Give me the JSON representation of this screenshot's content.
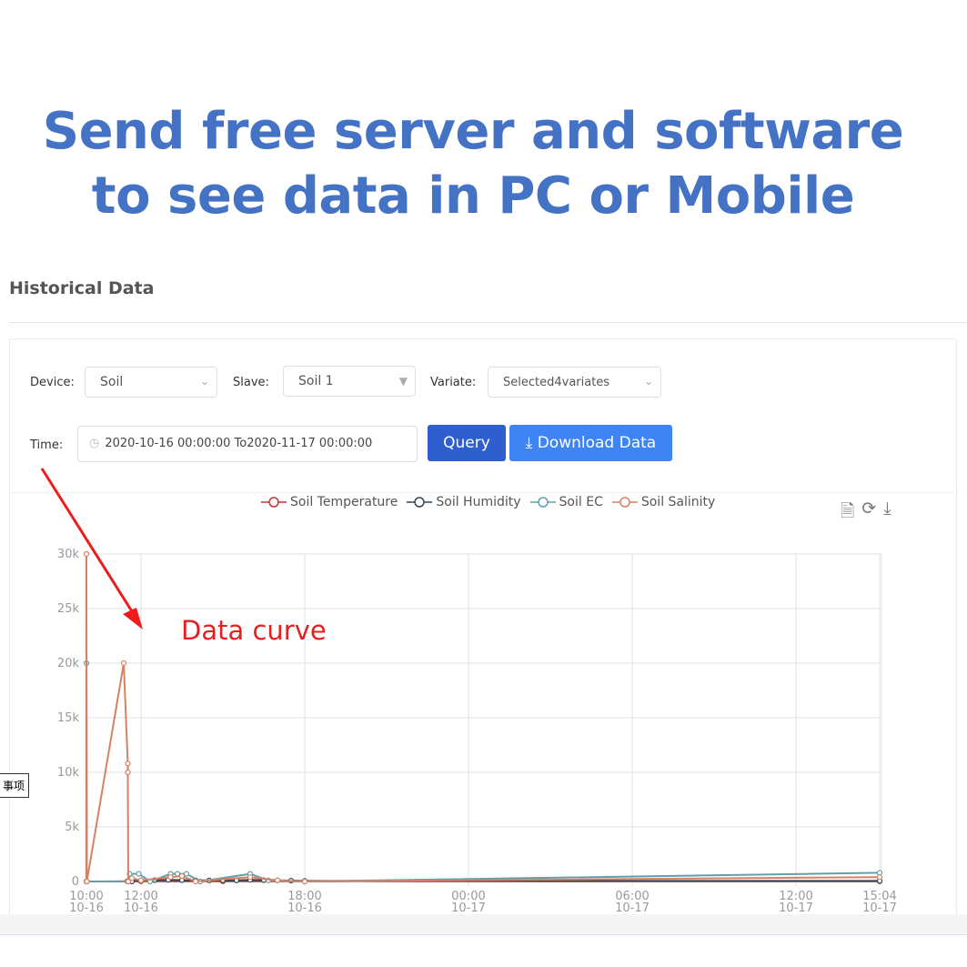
{
  "headline": {
    "line1": "Send free server and software",
    "line2": "to see data in PC or Mobile"
  },
  "page": {
    "title": "Historical Data"
  },
  "filters": {
    "device_label": "Device:",
    "device_value": "Soil",
    "slave_label": "Slave:",
    "slave_value": "Soil 1",
    "variate_label": "Variate:",
    "variate_value": "Selected4variates",
    "time_label": "Time:",
    "time_value": "2020-10-16 00:00:00 To2020-11-17 00:00:00"
  },
  "buttons": {
    "query": "Query",
    "download": "Download Data"
  },
  "annotation": "Data curve",
  "side_tab": "事项",
  "colors": {
    "title": "#4472c4",
    "query": "#2f5fcf",
    "download": "#3f84f5",
    "annotation": "#e62020"
  },
  "chart_data": {
    "type": "line",
    "ylim": [
      0,
      30000
    ],
    "yticks": [
      "0",
      "5k",
      "10k",
      "15k",
      "20k",
      "25k",
      "30k"
    ],
    "xticks": [
      {
        "t": "10-16 10:00",
        "l1": "10:00",
        "l2": "10-16"
      },
      {
        "t": "10-16 12:00",
        "l1": "12:00",
        "l2": "10-16"
      },
      {
        "t": "10-16 18:00",
        "l1": "18:00",
        "l2": "10-16"
      },
      {
        "t": "10-17 00:00",
        "l1": "00:00",
        "l2": "10-17"
      },
      {
        "t": "10-17 06:00",
        "l1": "06:00",
        "l2": "10-17"
      },
      {
        "t": "10-17 12:00",
        "l1": "12:00",
        "l2": "10-17"
      },
      {
        "t": "10-17 15:04",
        "l1": "15:04",
        "l2": "10-17"
      }
    ],
    "grid": true,
    "legend_position": "top",
    "series": [
      {
        "name": "Soil Temperature",
        "color": "#c23531",
        "points": [
          [
            "10-16 10:00",
            0
          ],
          [
            "10-16 11:30",
            20
          ],
          [
            "10-16 12:00",
            20
          ],
          [
            "10-16 15:00",
            20
          ],
          [
            "10-16 18:00",
            20
          ],
          [
            "10-17 15:04",
            20
          ]
        ]
      },
      {
        "name": "Soil Humidity",
        "color": "#2f4554",
        "points": [
          [
            "10-16 11:40",
            0
          ],
          [
            "10-16 12:00",
            100
          ],
          [
            "10-16 12:30",
            120
          ],
          [
            "10-16 13:00",
            150
          ],
          [
            "10-16 13:30",
            120
          ],
          [
            "10-16 14:00",
            100
          ],
          [
            "10-16 14:30",
            100
          ],
          [
            "10-16 15:00",
            100
          ],
          [
            "10-16 15:30",
            100
          ],
          [
            "10-16 16:00",
            150
          ],
          [
            "10-16 16:30",
            120
          ],
          [
            "10-16 17:00",
            100
          ],
          [
            "10-16 17:30",
            80
          ],
          [
            "10-16 18:00",
            50
          ],
          [
            "10-17 15:04",
            50
          ]
        ]
      },
      {
        "name": "Soil EC",
        "color": "#61a0a8",
        "points": [
          [
            "10-16 10:00",
            20000
          ],
          [
            "10-16 10:01",
            0
          ],
          [
            "10-16 11:32",
            0
          ],
          [
            "10-16 11:35",
            700
          ],
          [
            "10-16 11:55",
            700
          ],
          [
            "10-16 12:20",
            0
          ],
          [
            "10-16 13:05",
            700
          ],
          [
            "10-16 13:20",
            700
          ],
          [
            "10-16 13:40",
            700
          ],
          [
            "10-16 14:10",
            0
          ],
          [
            "10-16 16:00",
            700
          ],
          [
            "10-16 16:40",
            100
          ],
          [
            "10-16 18:00",
            0
          ],
          [
            "10-17 15:04",
            800
          ]
        ]
      },
      {
        "name": "Soil Salinity",
        "color": "#d48265",
        "points": [
          [
            "10-16 10:00",
            0
          ],
          [
            "10-16 10:00",
            30000
          ],
          [
            "10-16 10:01",
            0
          ],
          [
            "10-16 11:22",
            20000
          ],
          [
            "10-16 11:31",
            10800
          ],
          [
            "10-16 11:31",
            10000
          ],
          [
            "10-16 11:32",
            0
          ],
          [
            "10-16 11:40",
            300
          ],
          [
            "10-16 12:00",
            100
          ],
          [
            "10-16 13:05",
            400
          ],
          [
            "10-16 13:30",
            500
          ],
          [
            "10-16 14:00",
            0
          ],
          [
            "10-16 16:00",
            400
          ],
          [
            "10-16 17:00",
            100
          ],
          [
            "10-16 18:00",
            0
          ],
          [
            "10-17 15:04",
            400
          ]
        ]
      }
    ]
  }
}
